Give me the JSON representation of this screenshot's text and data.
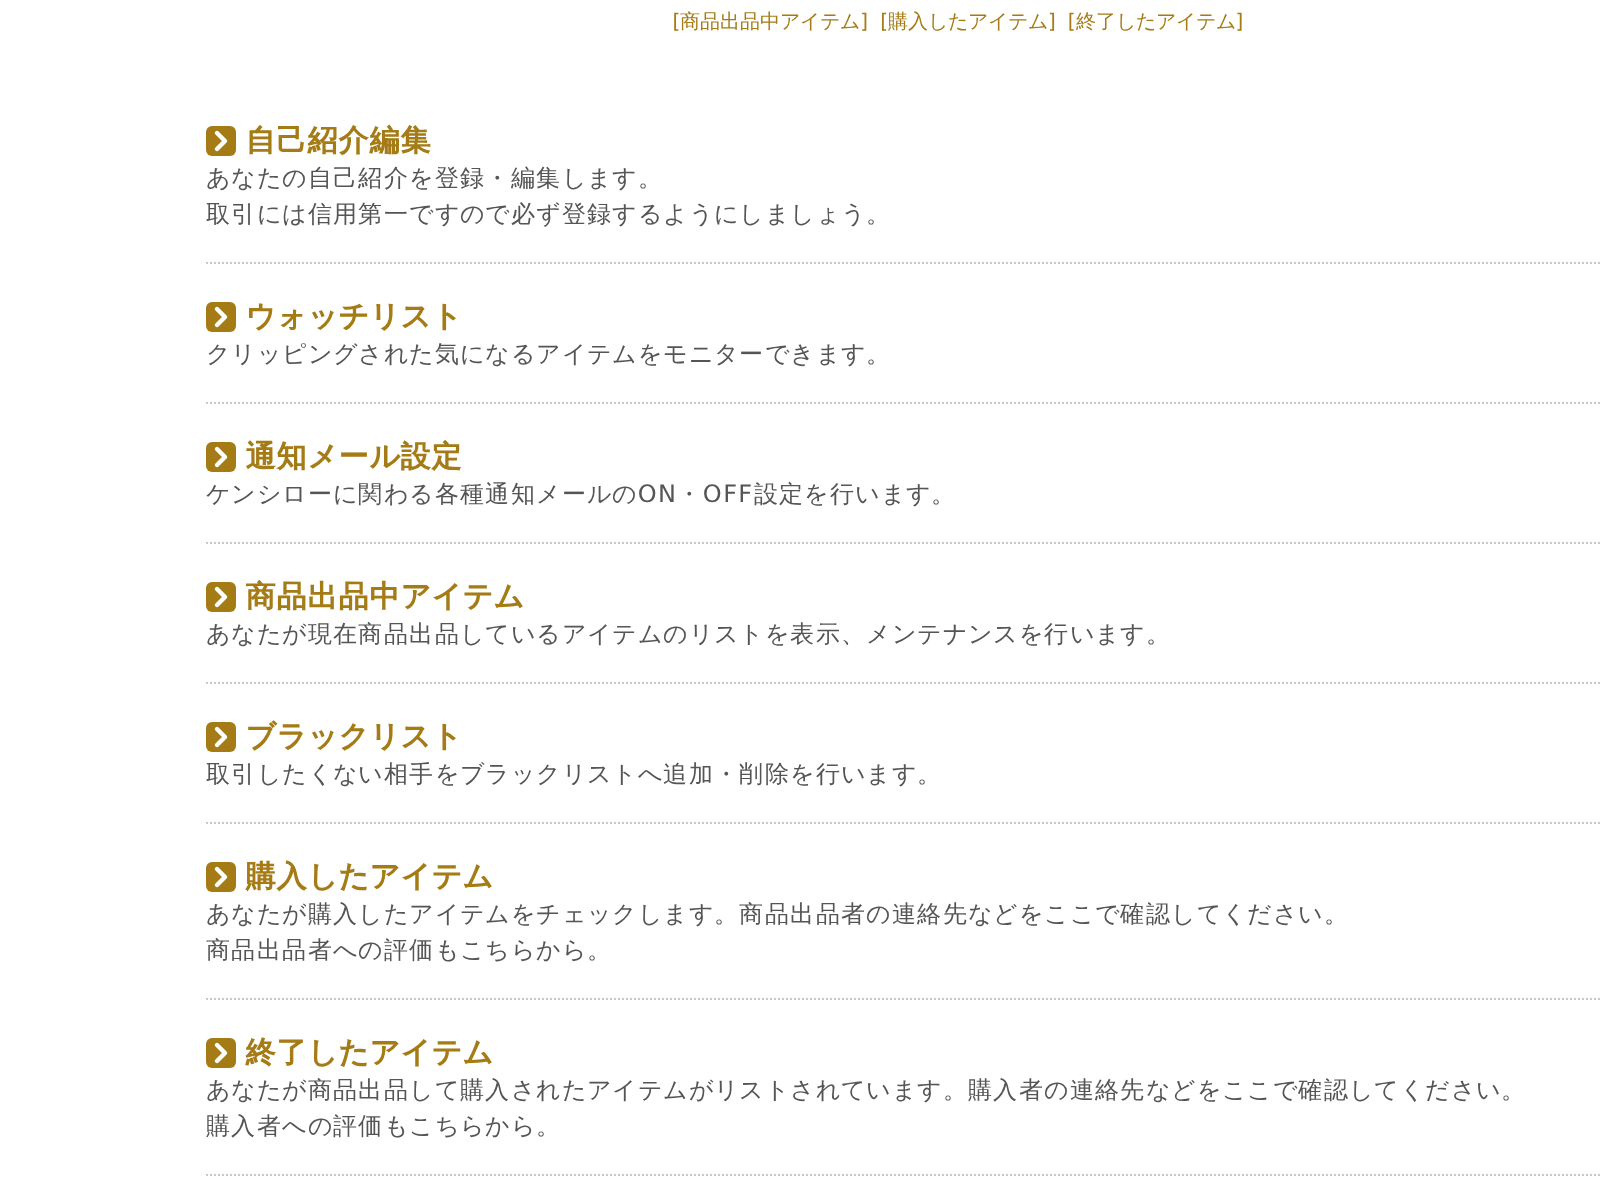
{
  "nav_links": [
    {
      "label": "[商品出品中アイテム]"
    },
    {
      "label": "[購入したアイテム]"
    },
    {
      "label": "[終了したアイテム]"
    }
  ],
  "sections": [
    {
      "title": "自己紹介編集",
      "lines": [
        "あなたの自己紹介を登録・編集します。",
        "取引には信用第一ですので必ず登録するようにしましょう。"
      ]
    },
    {
      "title": "ウォッチリスト",
      "lines": [
        "クリッピングされた気になるアイテムをモニターできます。"
      ]
    },
    {
      "title": "通知メール設定",
      "lines": [
        "ケンシローに関わる各種通知メールのON・OFF設定を行います。"
      ]
    },
    {
      "title": "商品出品中アイテム",
      "lines": [
        "あなたが現在商品出品しているアイテムのリストを表示、メンテナンスを行います。"
      ]
    },
    {
      "title": "ブラックリスト",
      "lines": [
        "取引したくない相手をブラックリストへ追加・削除を行います。"
      ]
    },
    {
      "title": "購入したアイテム",
      "lines": [
        "あなたが購入したアイテムをチェックします。商品出品者の連絡先などをここで確認してください。",
        "商品出品者への評価もこちらから。"
      ]
    },
    {
      "title": "終了したアイテム",
      "lines": [
        "あなたが商品出品して購入されたアイテムがリストされています。購入者の連絡先などをここで確認してください。",
        "購入者への評価もこちらから。"
      ]
    }
  ]
}
